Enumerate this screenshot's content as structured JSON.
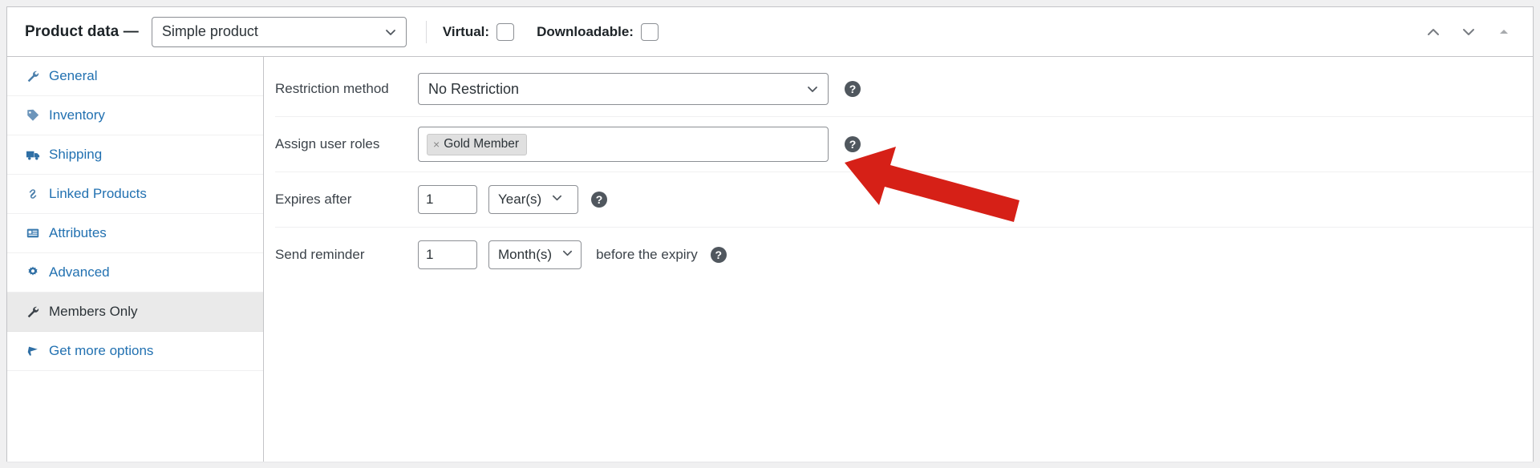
{
  "header": {
    "title": "Product data —",
    "product_type": {
      "value": "Simple product",
      "icon": "chevron-down-icon"
    },
    "virtual": {
      "label": "Virtual:",
      "checked": false
    },
    "downloadable": {
      "label": "Downloadable:",
      "checked": false
    },
    "actions": [
      {
        "name": "move-up",
        "icon": "chevron-up-icon"
      },
      {
        "name": "move-down",
        "icon": "chevron-down-icon"
      },
      {
        "name": "toggle-panel",
        "icon": "triangle-up-icon"
      }
    ]
  },
  "tabs": [
    {
      "label": "General",
      "icon": "wrench-icon",
      "active": false
    },
    {
      "label": "Inventory",
      "icon": "tag-icon",
      "active": false
    },
    {
      "label": "Shipping",
      "icon": "truck-icon",
      "active": false
    },
    {
      "label": "Linked Products",
      "icon": "link-icon",
      "active": false
    },
    {
      "label": "Attributes",
      "icon": "list-icon",
      "active": false
    },
    {
      "label": "Advanced",
      "icon": "gear-icon",
      "active": false
    },
    {
      "label": "Members Only",
      "icon": "wrench-icon",
      "active": true
    },
    {
      "label": "Get more options",
      "icon": "megaphone-icon",
      "active": false
    }
  ],
  "fields": {
    "restriction_method": {
      "label": "Restriction method",
      "value": "No Restriction",
      "help": "?"
    },
    "assign_user_roles": {
      "label": "Assign user roles",
      "tokens": [
        {
          "remove": "×",
          "label": "Gold Member"
        }
      ],
      "help": "?"
    },
    "expires_after": {
      "label": "Expires after",
      "amount": "1",
      "unit": "Year(s)",
      "help": "?"
    },
    "send_reminder": {
      "label": "Send reminder",
      "amount": "1",
      "unit": "Month(s)",
      "suffix": "before the expiry",
      "help": "?"
    }
  },
  "annotation": {
    "name": "red-arrow-pointer",
    "color": "#d62017"
  }
}
